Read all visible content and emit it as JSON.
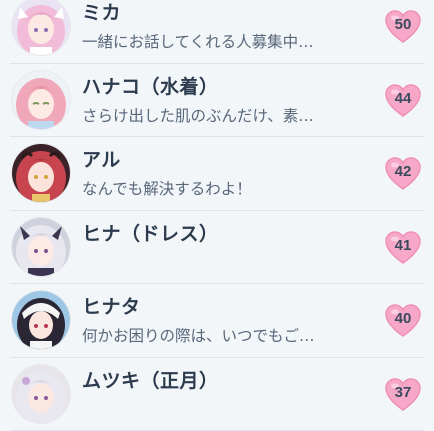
{
  "contacts": [
    {
      "name": "ミカ",
      "message": "一緒にお話してくれる人募集中…",
      "bond": "50",
      "avatar_icon": "mika-portrait-icon",
      "colors": {
        "bg": "#e9e3f3",
        "hair": "#f2bcd8",
        "face": "#fde9e3",
        "accent": "#ffffff"
      }
    },
    {
      "name": "ハナコ（水着）",
      "message": "さらけ出した肌のぶんだけ、素…",
      "bond": "44",
      "avatar_icon": "hanako-swimsuit-portrait-icon",
      "colors": {
        "bg": "#eef2f7",
        "hair": "#f0a7b9",
        "face": "#fdeae4",
        "accent": "#bcd8ef"
      }
    },
    {
      "name": "アル",
      "message": "なんでも解決するわよ！",
      "bond": "42",
      "avatar_icon": "aru-portrait-icon",
      "colors": {
        "bg": "#3a2228",
        "hair": "#c8454f",
        "face": "#fbe3dc",
        "accent": "#e8c46a"
      }
    },
    {
      "name": "ヒナ（ドレス）",
      "message": "",
      "bond": "41",
      "avatar_icon": "hina-dress-portrait-icon",
      "colors": {
        "bg": "#cfd2dc",
        "hair": "#e8e6ee",
        "face": "#fbeae6",
        "accent": "#3b3552"
      }
    },
    {
      "name": "ヒナタ",
      "message": "何かお困りの際は、いつでもご…",
      "bond": "40",
      "avatar_icon": "hinata-portrait-icon",
      "colors": {
        "bg": "#9ec7e6",
        "hair": "#2a2633",
        "face": "#fbe6df",
        "accent": "#f5f5f5"
      }
    },
    {
      "name": "ムツキ（正月）",
      "message": "",
      "bond": "37",
      "avatar_icon": "mutsuki-new-year-portrait-icon",
      "colors": {
        "bg": "#e7e4ea",
        "hair": "#e9e7ef",
        "face": "#fbe8e2",
        "accent": "#c9a7d8"
      }
    }
  ],
  "heart_color": "#f7a8c8",
  "heart_outline": "#f08fb6"
}
